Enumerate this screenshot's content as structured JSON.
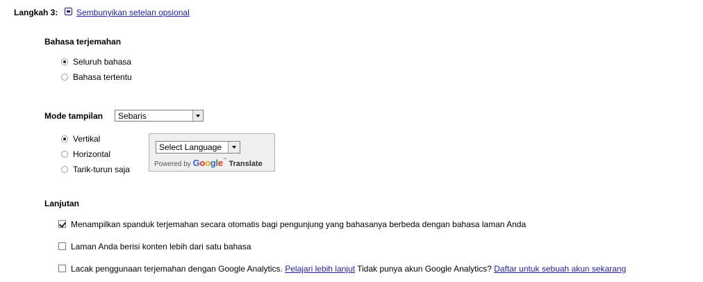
{
  "step": {
    "label": "Langkah 3:",
    "toggle_link": "Sembunyikan setelan opsional"
  },
  "translation_language": {
    "heading": "Bahasa terjemahan",
    "options": [
      {
        "label": "Seluruh bahasa",
        "checked": true
      },
      {
        "label": "Bahasa tertentu",
        "checked": false
      }
    ]
  },
  "display_mode": {
    "heading": "Mode tampilan",
    "selected": "Sebaris",
    "options": [
      {
        "label": "Vertikal",
        "checked": true
      },
      {
        "label": "Horizontal",
        "checked": false
      },
      {
        "label": "Tarik-turun saja",
        "checked": false
      }
    ],
    "preview": {
      "select_label": "Select Language",
      "powered_by": "Powered by",
      "google": "Google",
      "tm": "™",
      "translate": "Translate"
    }
  },
  "advanced": {
    "heading": "Lanjutan",
    "options": [
      {
        "label": "Menampilkan spanduk terjemahan secara otomatis bagi pengunjung yang bahasanya berbeda dengan bahasa laman Anda",
        "checked": true
      },
      {
        "label": "Laman Anda berisi konten lebih dari satu bahasa",
        "checked": false
      },
      {
        "label": "Lacak penggunaan terjemahan dengan Google Analytics.",
        "checked": false,
        "learn_more": "Pelajari lebih lanjut",
        "no_account": "Tidak punya akun Google Analytics?",
        "signup": "Daftar untuk sebuah akun sekarang"
      }
    ]
  },
  "colors": {
    "link": "#1f1fa9",
    "preview_background": "#efefef",
    "google_blue": "#3366cc",
    "google_red": "#dd3322",
    "google_yellow": "#e8a800",
    "google_green": "#339933"
  }
}
